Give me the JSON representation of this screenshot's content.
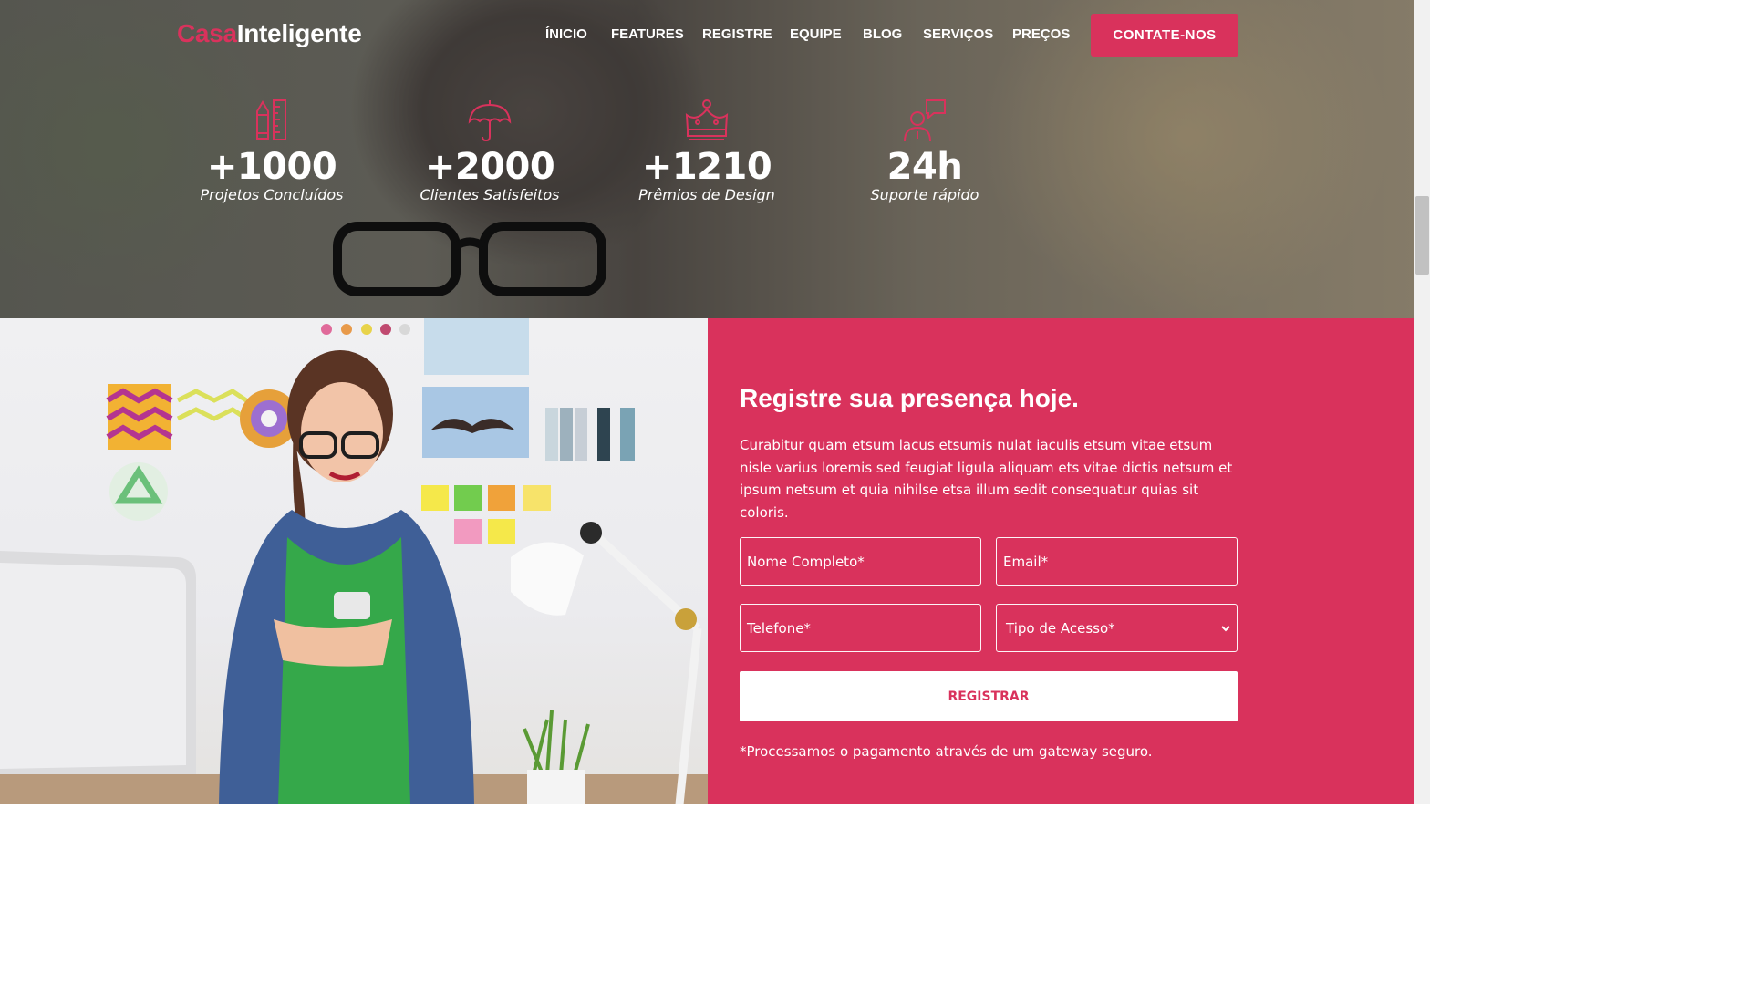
{
  "colors": {
    "accent": "#d9325c",
    "white": "#ffffff"
  },
  "header": {
    "logo_part1": "Casa",
    "logo_part2": "Inteligente",
    "nav": [
      "ÍNICIO",
      "FEATURES",
      "REGISTRE",
      "EQUIPE",
      "BLOG",
      "SERVIÇOS",
      "PREÇOS"
    ],
    "cta_label": "CONTATE-NOS"
  },
  "stats": [
    {
      "icon": "pencil-ruler-icon",
      "value": "+1000",
      "label": "Projetos Concluídos"
    },
    {
      "icon": "umbrella-icon",
      "value": "+2000",
      "label": "Clientes Satisfeitos"
    },
    {
      "icon": "crown-icon",
      "value": "+1210",
      "label": "Prêmios de Design"
    },
    {
      "icon": "support-chat-icon",
      "value": "24h",
      "label": "Suporte rápido"
    }
  ],
  "register": {
    "title": "Registre sua presença hoje.",
    "description": "Curabitur quam etsum lacus etsumis nulat iaculis etsum vitae etsum nisle varius loremis sed feugiat ligula aliquam ets vitae dictis netsum et ipsum netsum et quia nihilse etsa illum sedit consequatur quias sit coloris.",
    "fields": {
      "name_placeholder": "Nome Completo*",
      "email_placeholder": "Email*",
      "phone_placeholder": "Telefone*",
      "access_type_selected": "Tipo de Acesso*"
    },
    "submit_label": "REGISTRAR",
    "note": "*Processamos o pagamento através de um gateway seguro."
  }
}
